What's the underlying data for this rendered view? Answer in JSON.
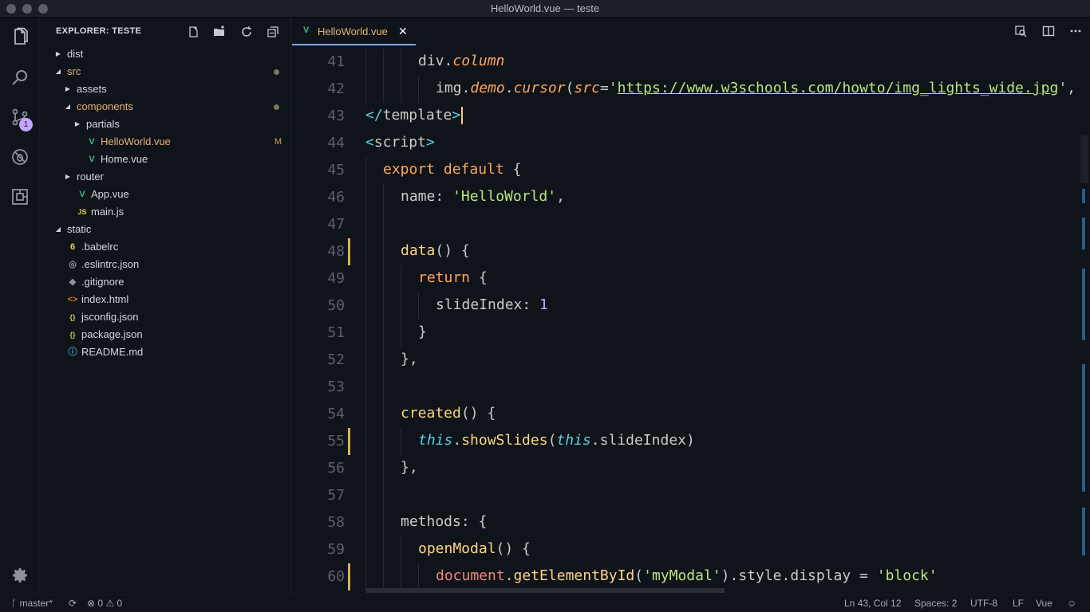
{
  "window": {
    "title": "HelloWorld.vue — teste"
  },
  "activity": {
    "scm_badge": "1"
  },
  "sidebar": {
    "title": "EXPLORER: TESTE",
    "tree": [
      {
        "label": "dist",
        "depth": 0,
        "kind": "folder",
        "expanded": false
      },
      {
        "label": "src",
        "depth": 0,
        "kind": "folder",
        "expanded": true,
        "modified": true,
        "color": "#e6b673"
      },
      {
        "label": "assets",
        "depth": 1,
        "kind": "folder",
        "expanded": false
      },
      {
        "label": "components",
        "depth": 1,
        "kind": "folder",
        "expanded": true,
        "modified": true,
        "color": "#e6b673"
      },
      {
        "label": "partials",
        "depth": 2,
        "kind": "folder",
        "expanded": false
      },
      {
        "label": "HelloWorld.vue",
        "depth": 2,
        "kind": "vue",
        "status": "M",
        "color": "#e6b673"
      },
      {
        "label": "Home.vue",
        "depth": 2,
        "kind": "vue"
      },
      {
        "label": "router",
        "depth": 1,
        "kind": "folder",
        "expanded": false
      },
      {
        "label": "App.vue",
        "depth": 1,
        "kind": "vue"
      },
      {
        "label": "main.js",
        "depth": 1,
        "kind": "js"
      },
      {
        "label": "static",
        "depth": 0,
        "kind": "folder",
        "expanded": true
      },
      {
        "label": ".babelrc",
        "depth": 0,
        "kind": "babel"
      },
      {
        "label": ".eslintrc.json",
        "depth": 0,
        "kind": "eslint"
      },
      {
        "label": ".gitignore",
        "depth": 0,
        "kind": "git"
      },
      {
        "label": "index.html",
        "depth": 0,
        "kind": "html"
      },
      {
        "label": "jsconfig.json",
        "depth": 0,
        "kind": "json"
      },
      {
        "label": "package.json",
        "depth": 0,
        "kind": "json"
      },
      {
        "label": "README.md",
        "depth": 0,
        "kind": "info"
      }
    ]
  },
  "tabs": [
    {
      "label": "HelloWorld.vue",
      "active": true
    }
  ],
  "editor": {
    "lines": [
      {
        "n": "41",
        "indent": 3,
        "tokens": [
          [
            "g",
            "div."
          ],
          [
            "m",
            "column"
          ]
        ]
      },
      {
        "n": "42",
        "indent": 4,
        "tokens": [
          [
            "g",
            "img."
          ],
          [
            "m",
            "demo"
          ],
          [
            "g",
            "."
          ],
          [
            "m",
            "cursor"
          ],
          [
            "g",
            "("
          ],
          [
            "m",
            "src"
          ],
          [
            "g",
            "='"
          ],
          [
            "u",
            "https://www.w3schools.com/howto/img_lights_wide.jpg"
          ],
          [
            "g",
            "',"
          ]
        ]
      },
      {
        "n": "43",
        "indent": 0,
        "tokens": [
          [
            "t",
            "</"
          ],
          [
            "g",
            "template"
          ],
          [
            "t",
            ">"
          ]
        ],
        "cursor": true
      },
      {
        "n": "44",
        "indent": 0,
        "tokens": [
          [
            "t",
            "<"
          ],
          [
            "g",
            "script"
          ],
          [
            "t",
            ">"
          ]
        ]
      },
      {
        "n": "45",
        "indent": 1,
        "tokens": [
          [
            "k",
            "export default "
          ],
          [
            "g",
            "{"
          ]
        ]
      },
      {
        "n": "46",
        "indent": 2,
        "tokens": [
          [
            "g",
            "name: "
          ],
          [
            "s",
            "'HelloWorld'"
          ],
          [
            "g",
            ","
          ]
        ]
      },
      {
        "n": "47",
        "indent": 2,
        "tokens": []
      },
      {
        "n": "48",
        "indent": 2,
        "tokens": [
          [
            "f",
            "data"
          ],
          [
            "g",
            "() {"
          ]
        ],
        "mark": true
      },
      {
        "n": "49",
        "indent": 3,
        "tokens": [
          [
            "k",
            "return "
          ],
          [
            "g",
            "{"
          ]
        ]
      },
      {
        "n": "50",
        "indent": 4,
        "tokens": [
          [
            "g",
            "slideIndex: "
          ],
          [
            "v",
            "1"
          ]
        ]
      },
      {
        "n": "51",
        "indent": 3,
        "tokens": [
          [
            "g",
            "}"
          ]
        ]
      },
      {
        "n": "52",
        "indent": 2,
        "tokens": [
          [
            "g",
            "},"
          ]
        ]
      },
      {
        "n": "53",
        "indent": 2,
        "tokens": []
      },
      {
        "n": "54",
        "indent": 2,
        "tokens": [
          [
            "f",
            "created"
          ],
          [
            "g",
            "() {"
          ]
        ]
      },
      {
        "n": "55",
        "indent": 3,
        "tokens": [
          [
            "i",
            "this"
          ],
          [
            "g",
            "."
          ],
          [
            "f",
            "showSlides"
          ],
          [
            "g",
            "("
          ],
          [
            "i",
            "this"
          ],
          [
            "g",
            "."
          ],
          [
            "g",
            "slideIndex)"
          ]
        ],
        "mark": true
      },
      {
        "n": "56",
        "indent": 2,
        "tokens": [
          [
            "g",
            "},"
          ]
        ]
      },
      {
        "n": "57",
        "indent": 2,
        "tokens": []
      },
      {
        "n": "58",
        "indent": 2,
        "tokens": [
          [
            "g",
            "methods: {"
          ]
        ]
      },
      {
        "n": "59",
        "indent": 3,
        "tokens": [
          [
            "f",
            "openModal"
          ],
          [
            "g",
            "() {"
          ]
        ]
      },
      {
        "n": "60",
        "indent": 4,
        "tokens": [
          [
            "r",
            "document"
          ],
          [
            "g",
            "."
          ],
          [
            "f",
            "getElementById"
          ],
          [
            "g",
            "("
          ],
          [
            "s",
            "'myModal'"
          ],
          [
            "g",
            ").style.display = "
          ],
          [
            "s",
            "'block'"
          ]
        ],
        "mark": true
      }
    ]
  },
  "status": {
    "branch": "master*",
    "errors": "0",
    "warnings": "0",
    "position": "Ln 43, Col 12",
    "spaces": "Spaces: 2",
    "encoding": "UTF-8",
    "eol": "LF",
    "language": "Vue"
  }
}
